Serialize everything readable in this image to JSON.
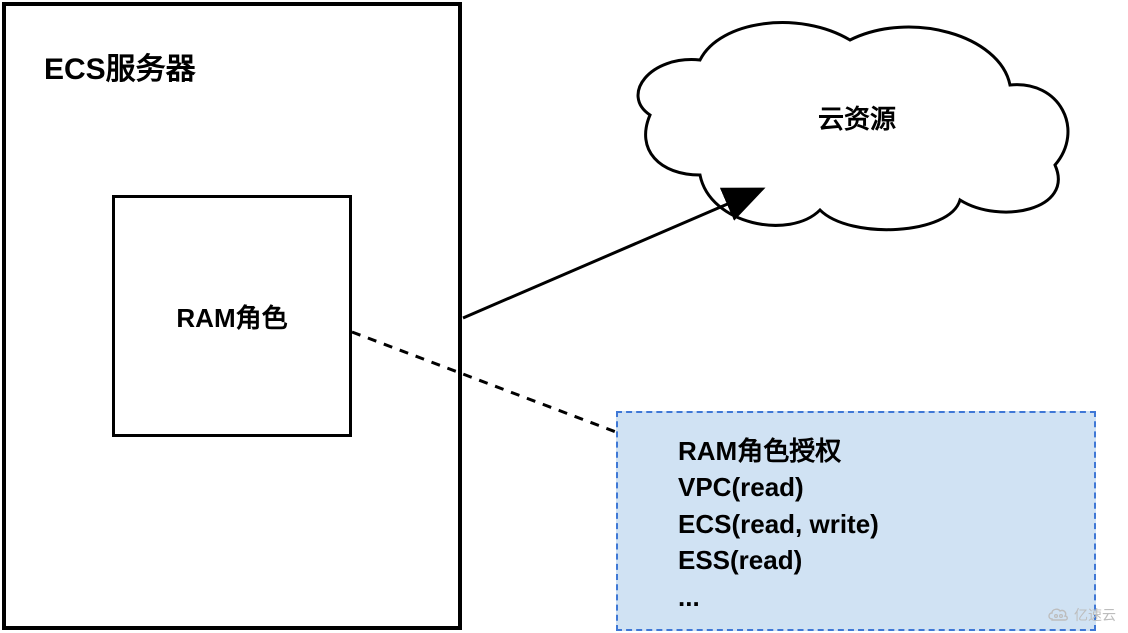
{
  "ecs_box": {
    "title": "ECS服务器",
    "role_box": {
      "label": "RAM角色"
    }
  },
  "cloud": {
    "label": "云资源"
  },
  "permissions_box": {
    "title": "RAM角色授权",
    "entries": [
      "VPC(read)",
      "ECS(read, write)",
      "ESS(read)",
      "..."
    ]
  },
  "watermark": {
    "text": "亿速云"
  }
}
